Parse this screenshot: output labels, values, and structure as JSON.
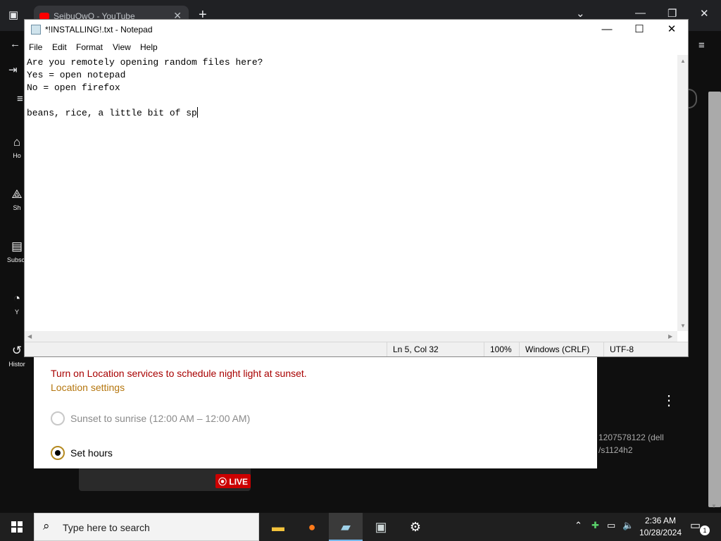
{
  "browser": {
    "tab_title": "SeibuOwO - YouTube",
    "nav_home": "Ho",
    "nav_shorts": "Sh",
    "nav_subs": "Subscr",
    "nav_you": "Y",
    "nav_history": "Histor",
    "desc_line1": "1207578122 (dell",
    "desc_line2": "/s1124h2",
    "live_badge": "LIVE"
  },
  "settings": {
    "location_warning": "Turn on Location services to schedule night light at sunset.",
    "location_link": "Location settings",
    "option_sunset": "Sunset to sunrise (12:00 AM – 12:00 AM)",
    "option_set_hours": "Set hours",
    "selected": "Set hours"
  },
  "notepad": {
    "title": "*!INSTALLING!.txt - Notepad",
    "menu": [
      "File",
      "Edit",
      "Format",
      "View",
      "Help"
    ],
    "content": "Are you remotely opening random files here?\nYes = open notepad\nNo = open firefox\n\nbeans, rice, a little bit of sp",
    "status": {
      "position": "Ln 5, Col 32",
      "zoom": "100%",
      "line_endings": "Windows (CRLF)",
      "encoding": "UTF-8"
    }
  },
  "taskbar": {
    "search_placeholder": "Type here to search",
    "time": "2:36 AM",
    "date": "10/28/2024",
    "notification_count": "1",
    "apps": [
      "file-explorer",
      "firefox",
      "notepad",
      "window-app",
      "settings"
    ]
  },
  "colors": {
    "warning": "#a80000",
    "link": "#b5760e",
    "taskbar": "#1f1f1f",
    "live": "#cc0000"
  }
}
